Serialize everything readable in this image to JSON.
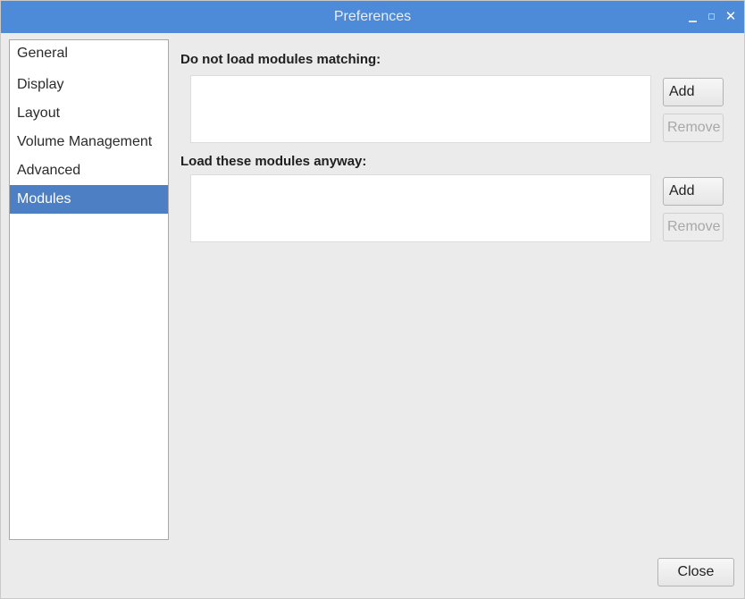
{
  "window": {
    "title": "Preferences"
  },
  "sidebar": {
    "items": [
      {
        "label": "General",
        "selected": false
      },
      {
        "label": "Display",
        "selected": false
      },
      {
        "label": "Layout",
        "selected": false
      },
      {
        "label": "Volume Management",
        "selected": false
      },
      {
        "label": "Advanced",
        "selected": false
      },
      {
        "label": "Modules",
        "selected": true
      }
    ]
  },
  "main": {
    "block_section": {
      "label": "Do not load modules matching:",
      "add_label": "Add",
      "remove_label": "Remove"
    },
    "load_section": {
      "label": "Load these modules anyway:",
      "add_label": "Add",
      "remove_label": "Remove"
    }
  },
  "footer": {
    "close_label": "Close"
  },
  "colors": {
    "titlebar": "#4d8ad8",
    "selection": "#4d7fc4",
    "window_bg": "#ebebeb"
  },
  "icons": {
    "minimize": "minimize-icon",
    "maximize": "maximize-icon",
    "close": "close-icon"
  }
}
